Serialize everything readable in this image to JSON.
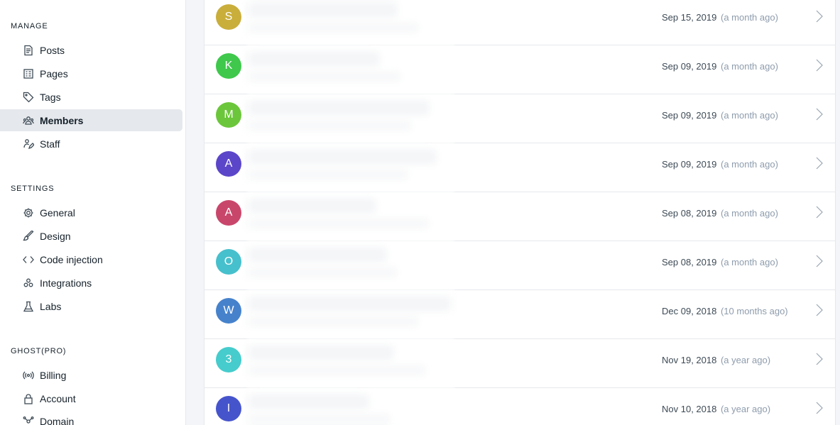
{
  "sidebar": {
    "manage_title": "MANAGE",
    "settings_title": "SETTINGS",
    "ghost_title": "GHOST(PRO)",
    "manage_items": [
      {
        "label": "Posts",
        "icon": "posts-icon"
      },
      {
        "label": "Pages",
        "icon": "pages-icon"
      },
      {
        "label": "Tags",
        "icon": "tags-icon"
      },
      {
        "label": "Members",
        "icon": "members-icon",
        "active": true
      },
      {
        "label": "Staff",
        "icon": "staff-icon"
      }
    ],
    "settings_items": [
      {
        "label": "General",
        "icon": "gear-icon"
      },
      {
        "label": "Design",
        "icon": "brush-icon"
      },
      {
        "label": "Code injection",
        "icon": "code-icon"
      },
      {
        "label": "Integrations",
        "icon": "integrations-icon"
      },
      {
        "label": "Labs",
        "icon": "flask-icon"
      }
    ],
    "ghost_items": [
      {
        "label": "Billing",
        "icon": "billing-icon"
      },
      {
        "label": "Account",
        "icon": "lock-icon"
      },
      {
        "label": "Domain",
        "icon": "domain-icon"
      }
    ]
  },
  "members": [
    {
      "initial": "S",
      "color": "#c9ae3b",
      "date": "Sep 15, 2019",
      "ago": "(a month ago)"
    },
    {
      "initial": "K",
      "color": "#3fc84c",
      "date": "Sep 09, 2019",
      "ago": "(a month ago)"
    },
    {
      "initial": "M",
      "color": "#6cc63b",
      "date": "Sep 09, 2019",
      "ago": "(a month ago)"
    },
    {
      "initial": "A",
      "color": "#5b46c9",
      "date": "Sep 09, 2019",
      "ago": "(a month ago)"
    },
    {
      "initial": "A",
      "color": "#c9466b",
      "date": "Sep 08, 2019",
      "ago": "(a month ago)"
    },
    {
      "initial": "O",
      "color": "#46c0cc",
      "date": "Sep 08, 2019",
      "ago": "(a month ago)"
    },
    {
      "initial": "W",
      "color": "#4682cc",
      "date": "Dec 09, 2018",
      "ago": "(10 months ago)"
    },
    {
      "initial": "3",
      "color": "#46cccc",
      "date": "Nov 19, 2018",
      "ago": "(a year ago)"
    },
    {
      "initial": "I",
      "color": "#4654cc",
      "date": "Nov 10, 2018",
      "ago": "(a year ago)"
    }
  ]
}
